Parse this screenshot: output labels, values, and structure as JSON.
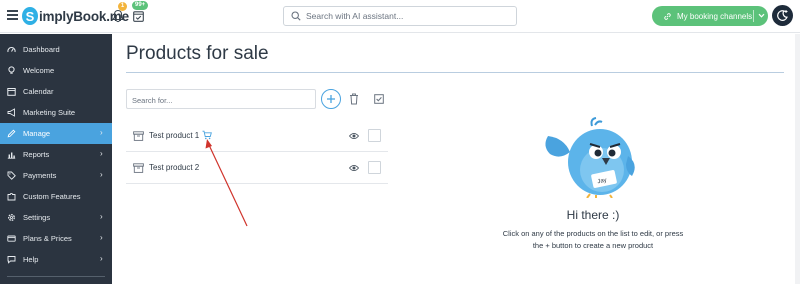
{
  "header": {
    "logo_text": "implyBook.me",
    "logo_mark": "S",
    "notifications_badge": "1",
    "bookings_badge": "99+",
    "search_placeholder": "Search with AI assistant...",
    "channels_label": "My booking channels",
    "channels_color": "#5cc27a"
  },
  "sidebar": {
    "items": [
      {
        "label": "Dashboard",
        "icon": "dashboard-icon",
        "arrow": false,
        "active": false
      },
      {
        "label": "Welcome",
        "icon": "lightbulb-icon",
        "arrow": false,
        "active": false
      },
      {
        "label": "Calendar",
        "icon": "calendar-icon",
        "arrow": false,
        "active": false
      },
      {
        "label": "Marketing Suite",
        "icon": "megaphone-icon",
        "arrow": false,
        "active": false
      },
      {
        "label": "Manage",
        "icon": "pencil-icon",
        "arrow": true,
        "active": true
      },
      {
        "label": "Reports",
        "icon": "bar-chart-icon",
        "arrow": true,
        "active": false
      },
      {
        "label": "Payments",
        "icon": "tag-icon",
        "arrow": true,
        "active": false
      },
      {
        "label": "Custom Features",
        "icon": "puzzle-icon",
        "arrow": false,
        "active": false
      },
      {
        "label": "Settings",
        "icon": "gear-icon",
        "arrow": true,
        "active": false
      },
      {
        "label": "Plans & Prices",
        "icon": "card-icon",
        "arrow": true,
        "active": false
      },
      {
        "label": "Help",
        "icon": "chat-icon",
        "arrow": true,
        "active": false
      }
    ],
    "active_color": "#4aa3df"
  },
  "main": {
    "title": "Products for sale",
    "search_placeholder": "Search for...",
    "products": [
      {
        "name": "Test product 1",
        "has_cart": true
      },
      {
        "name": "Test product 2",
        "has_cart": false
      }
    ],
    "empty_state": {
      "greeting": "Hi there :)",
      "line1": "Click on any of the products on the list to edit, or press",
      "line2": "the + button to create a new product",
      "bird_badge": "Jay"
    }
  }
}
